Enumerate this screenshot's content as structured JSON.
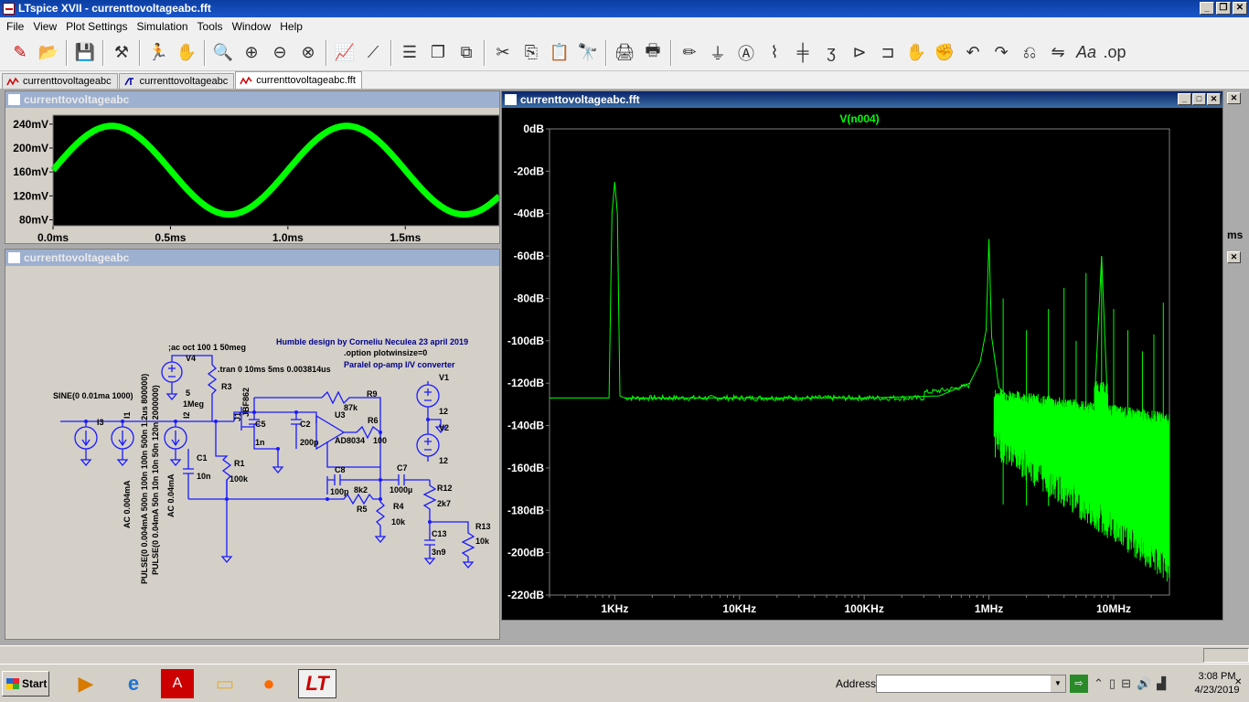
{
  "app": {
    "title": "LTspice XVII - currenttovoltageabc.fft"
  },
  "menu": [
    "File",
    "View",
    "Plot Settings",
    "Simulation",
    "Tools",
    "Window",
    "Help"
  ],
  "tabs": [
    {
      "label": "currenttovoltageabc",
      "icon": "waveform-icon"
    },
    {
      "label": "currenttovoltageabc",
      "icon": "schematic-icon"
    },
    {
      "label": "currenttovoltageabc.fft",
      "icon": "waveform-icon"
    }
  ],
  "time_plot": {
    "title": "currenttovoltageabc",
    "color": "#00ff00",
    "y_ticks": [
      "240mV",
      "200mV",
      "160mV",
      "120mV",
      "80mV"
    ],
    "x_ticks": [
      "0.0ms",
      "0.5ms",
      "1.0ms",
      "1.5ms"
    ],
    "right_label": "ms"
  },
  "schematic": {
    "title": "currenttovoltageabc",
    "texts": {
      "design": "Humble design by Corneliu Neculea 23 april 2019",
      "option": ".option plotwinsize=0",
      "paralel": "Paralel op-amp I/V converter",
      "ac_oct": ";ac oct 100 1 50meg",
      "tran": ".tran 0 10ms 5ms 0.003814us",
      "sine": "SINE(0 0.01ma 1000)",
      "pulse1": "PULSE(0 0.004mA 500n 100n 100n 500n 1.2us 800000)",
      "pulse2": "PULSE(0 0.04mA 50n 10n 10n 50n 120n 2000000)",
      "ac1": "AC 0.004mA",
      "ac2": "AC 0.04mA",
      "v4": "V4",
      "v4val": "5",
      "r3": "R3",
      "r3val": "1Meg",
      "j1": "J1",
      "j1model": "JBF862",
      "r9": "R9",
      "r9val": "87k",
      "u3": "U3",
      "u3model": "AD8034",
      "r6": "R6",
      "r6val": "100",
      "c5": "C5",
      "c5val": "1n",
      "c2": "C2",
      "c2val": "200p",
      "c1": "C1",
      "c1val": "10n",
      "r1": "R1",
      "r1val": "100k",
      "c8": "C8",
      "c8val": "100p",
      "r5": "R5",
      "r5val": "8k2",
      "c7": "C7",
      "c7val": "1000µ",
      "r4": "R4",
      "r4val": "10k",
      "r12": "R12",
      "r12val": "2k7",
      "c13": "C13",
      "c13val": "3n9",
      "r13": "R13",
      "r13val": "10k",
      "v1": "V1",
      "v1val": "12",
      "v2": "V2",
      "v2val": "12",
      "i3": "I3",
      "i1": "I1",
      "i2": "I2"
    }
  },
  "fft": {
    "title": "currenttovoltageabc.fft",
    "trace": "V(n004)",
    "color": "#00ff00",
    "y_ticks": [
      "0dB",
      "-20dB",
      "-40dB",
      "-60dB",
      "-80dB",
      "-100dB",
      "-120dB",
      "-140dB",
      "-160dB",
      "-180dB",
      "-200dB",
      "-220dB"
    ],
    "x_ticks": [
      "1KHz",
      "10KHz",
      "100KHz",
      "1MHz",
      "10MHz"
    ]
  },
  "chart_data": [
    {
      "type": "line",
      "xlabel": "",
      "ylabel": "",
      "x_unit": "ms",
      "y_unit": "mV",
      "xlim": [
        0,
        1.9
      ],
      "ylim": [
        70,
        255
      ],
      "series": [
        {
          "name": "",
          "x": [
            0,
            0.25,
            0.5,
            0.75,
            1.0,
            1.25,
            1.5,
            1.75,
            1.9
          ],
          "values": [
            163,
            237,
            163,
            89,
            163,
            237,
            163,
            89,
            129
          ]
        }
      ],
      "grid": false
    },
    {
      "type": "line",
      "title": "V(n004)",
      "xlabel": "",
      "ylabel": "",
      "x_scale": "log",
      "x_unit": "Hz",
      "y_unit": "dB",
      "xlim": [
        300,
        28000000
      ],
      "ylim": [
        -220,
        0
      ],
      "series": [
        {
          "name": "V(n004)",
          "x": [
            300,
            900,
            950,
            1000,
            1050,
            1100,
            1200,
            5000,
            20000,
            100000,
            400000,
            700000,
            850000,
            950000,
            1000000,
            1050000,
            1200000,
            2000000,
            4000000,
            7000000,
            8000000,
            9000000,
            15000000,
            28000000
          ],
          "values": [
            -127,
            -127,
            -40,
            -25,
            -40,
            -126,
            -127,
            -127,
            -127,
            -127,
            -126,
            -120,
            -110,
            -95,
            -52,
            -98,
            -122,
            -135,
            -145,
            -130,
            -60,
            -135,
            -170,
            -195
          ]
        }
      ],
      "grid": false
    }
  ],
  "taskbar": {
    "start": "Start",
    "address_label": "Address",
    "address_value": "",
    "time": "3:08 PM",
    "date": "4/23/2019"
  }
}
